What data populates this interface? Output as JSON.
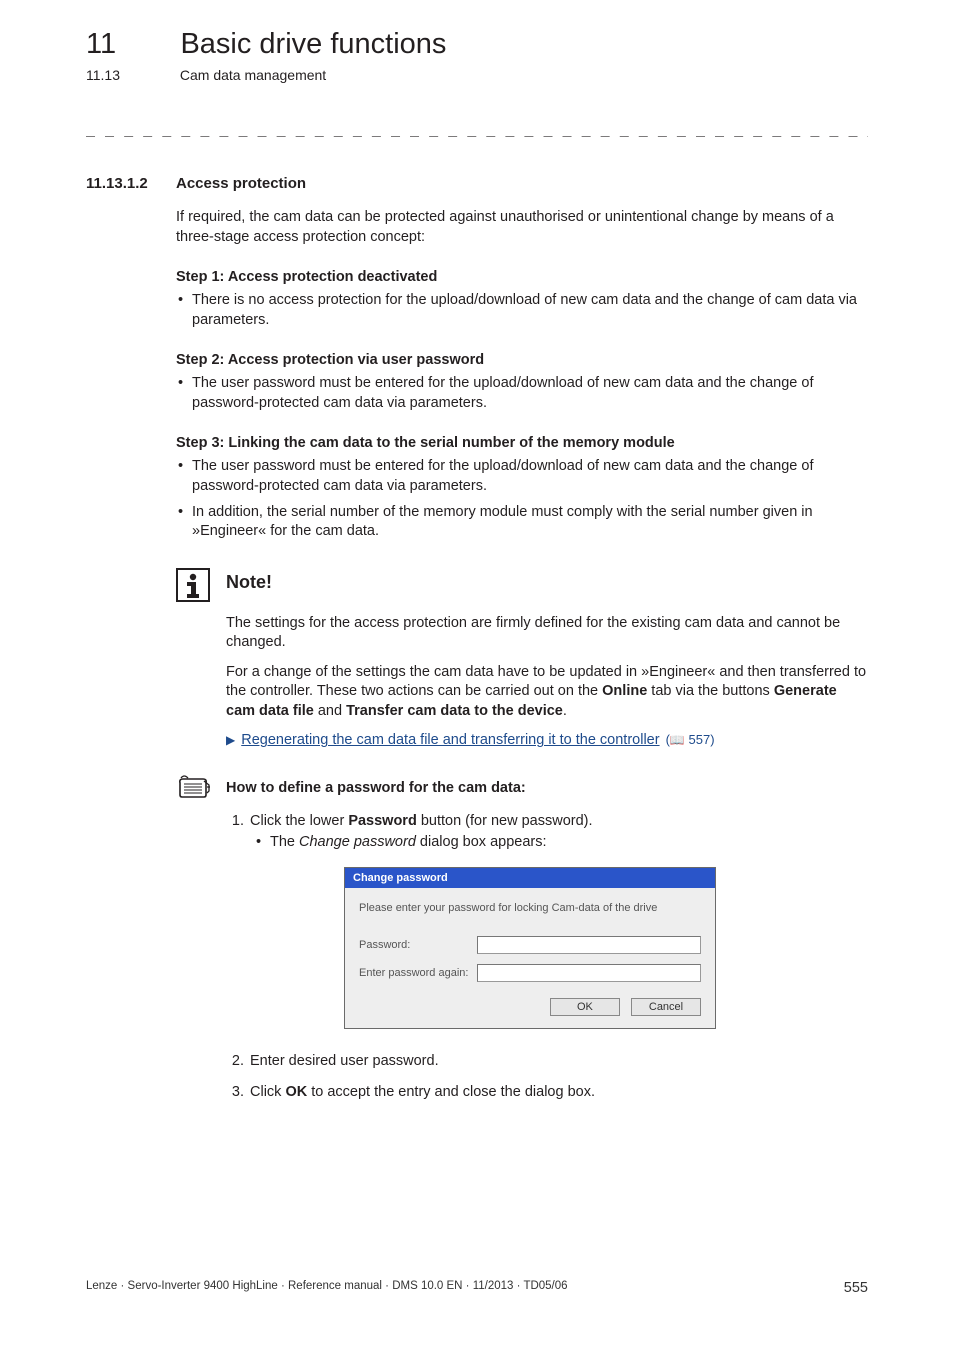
{
  "header": {
    "chapter_num": "11",
    "chapter_title": "Basic drive functions",
    "sub_num": "11.13",
    "sub_title": "Cam data management"
  },
  "separator": "_ _ _ _ _ _ _ _ _ _ _ _ _ _ _ _ _ _ _ _ _ _ _ _ _ _ _ _ _ _ _ _ _ _ _ _ _ _ _ _ _ _ _ _ _ _ _ _ _ _ _ _ _ _ _ _ _ _ _ _ _ _ _ _",
  "section": {
    "num": "11.13.1.2",
    "title": "Access protection",
    "intro": "If required, the cam data can be protected against unauthorised or unintentional change by means of a three-stage access protection concept:"
  },
  "steps": [
    {
      "title": "Step 1:  Access protection deactivated",
      "bullets": [
        "There is no access protection for the upload/download of new cam data and the change of cam data via parameters."
      ]
    },
    {
      "title": "Step 2: Access protection via user password",
      "bullets": [
        "The user password must be entered for the upload/download of new cam data and the change of password-protected cam data via parameters."
      ]
    },
    {
      "title": "Step 3: Linking the cam data to the serial number of the memory module",
      "bullets": [
        "The user password must be entered for the upload/download of new cam data and the change of password-protected cam data via parameters.",
        "In addition, the serial number of the memory module must comply with the serial number given in »Engineer« for the cam data."
      ]
    }
  ],
  "note": {
    "title": "Note!",
    "p1": "The settings for the access protection are firmly defined for the existing cam data and cannot be changed.",
    "p2_pre": "For a change of the settings the cam data have to be updated in »Engineer« and then transferred to the controller. These two actions can be carried out on the ",
    "p2_bold1": "Online",
    "p2_mid": " tab via the buttons ",
    "p2_bold2": "Generate cam data file",
    "p2_and": " and ",
    "p2_bold3": "Transfer cam data to the device",
    "p2_end": ".",
    "link_text": "Regenerating the cam data file and transferring it to the controller",
    "link_page": "557"
  },
  "howto": {
    "title": "How to define a password for the cam data:",
    "items": [
      {
        "n": "1.",
        "pre": "Click the lower ",
        "bold": "Password",
        "post": " button (for new password)."
      }
    ],
    "sub_pre": "The ",
    "sub_italic": "Change password",
    "sub_post": " dialog box appears:",
    "after": [
      {
        "n": "2.",
        "text": "Enter desired user password."
      },
      {
        "n": "3.",
        "pre": "Click ",
        "bold": "OK",
        "post": " to accept the entry and close the dialog box."
      }
    ]
  },
  "dialog": {
    "title": "Change password",
    "prompt": "Please enter your password for locking Cam-data of the drive",
    "label1": "Password:",
    "label2": "Enter password again:",
    "ok": "OK",
    "cancel": "Cancel"
  },
  "footer": {
    "left": "Lenze · Servo-Inverter 9400 HighLine · Reference manual · DMS 10.0 EN · 11/2013 · TD05/06",
    "page": "555"
  }
}
